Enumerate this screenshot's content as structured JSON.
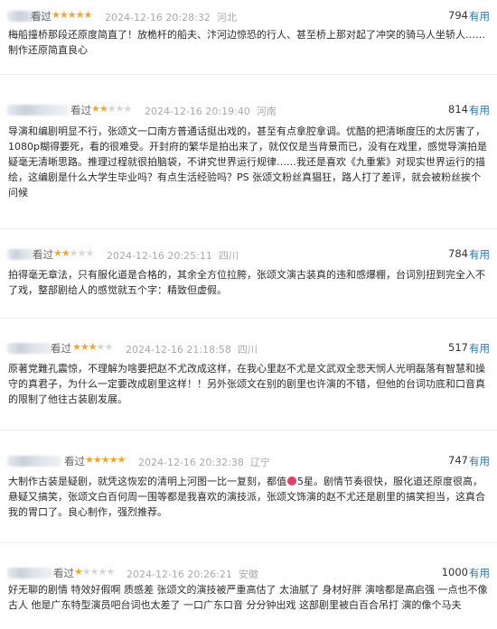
{
  "reviews": [
    {
      "watched": "看过",
      "stars": 5,
      "time": "2024-12-16 20:28:32",
      "location": "河北",
      "count": "794",
      "useful": "有用",
      "text": "梅船撞桥那段还原度简直了！放桅杆的船夫、汴河边惊恐的行人、甚至桥上那对起了冲突的骑马人坐轿人……制作还原简直良心"
    },
    {
      "watched": "看过",
      "stars": 2,
      "time": "2024-12-16 20:19:40",
      "location": "河南",
      "count": "814",
      "useful": "有用",
      "text": "导演和编剧明显不行，张颂文一口南方普通话挺出戏的，甚至有点拿腔拿调。优酷的把清晰度压的太厉害了，1080p糊得要死，看的很难受。开封府的繁华是拍出来了，就仅仅是当背景而已，没有在戏里，感觉导演拍是疑毫无清晰思路。推理过程就很拍脑袋，不讲究世界运行规律……我还是喜欢《九重紫》对现实世界运行的描绘，这编剧是什么大学生毕业吗？有点生活经验吗？PS 张颂文粉丝真猖狂，路人打了差评，就会被粉丝挨个问候"
    },
    {
      "watched": "看过",
      "stars": 2,
      "time": "2024-12-16 20:25:11",
      "location": "四川",
      "count": "784",
      "useful": "有用",
      "text": "拍得毫无章法，只有服化道是合格的，其余全方位拉胯，张颂文演古装真的违和感爆棚，台词別扭到完全入不了戏，整部剧给人的感觉就五个字：精致但虚假。"
    },
    {
      "watched": "看过",
      "stars": 3,
      "time": "2024-12-16 21:18:58",
      "location": "四川",
      "count": "517",
      "useful": "有用",
      "text": "原著党難孔震惊，不理解为啥要把赵不尤改成这样，在我心里赵不尤是文武双全悲天悯人光明磊落有智慧和操守的真君子，为什么一定要改成剧里这样！！另外张颂文在别的剧里也许演的不错，但他的台词功底和口音真的限制了他往古装剧发展。"
    },
    {
      "watched": "看过",
      "stars": 5,
      "time": "2024-12-16 20:32:38",
      "location": "辽宁",
      "count": "747",
      "useful": "有用",
      "text_a": "大制作古装是疑剧，就凭这恢宏的清明上河图一比一复刻，都值",
      "text_b": "5星。剧情节奏很快，服化道还原度很高，悬疑又搞笑，张颂文白百何周一围等都是我喜欢的演技派，张颂文饰演的赵不尤还是剧里的搞笑担当，这真合我的胃口了。良心制作，强烈推荐。"
    },
    {
      "watched": "看过",
      "stars": 1,
      "time": "2024-12-16 20:26:21",
      "location": "安徽",
      "count": "1000",
      "useful": "有用",
      "text": "好无聊的剧情 特效好假啊 质感差 张颂文的演技被严重高估了 太油腻了 身材好胖 演啥都是高启强 一点也不像古人 他是广东特型演员吧台词也太差了 一口广东口音 分分钟出戏 这部剧里被白百合吊打 演的像个马夫"
    }
  ]
}
